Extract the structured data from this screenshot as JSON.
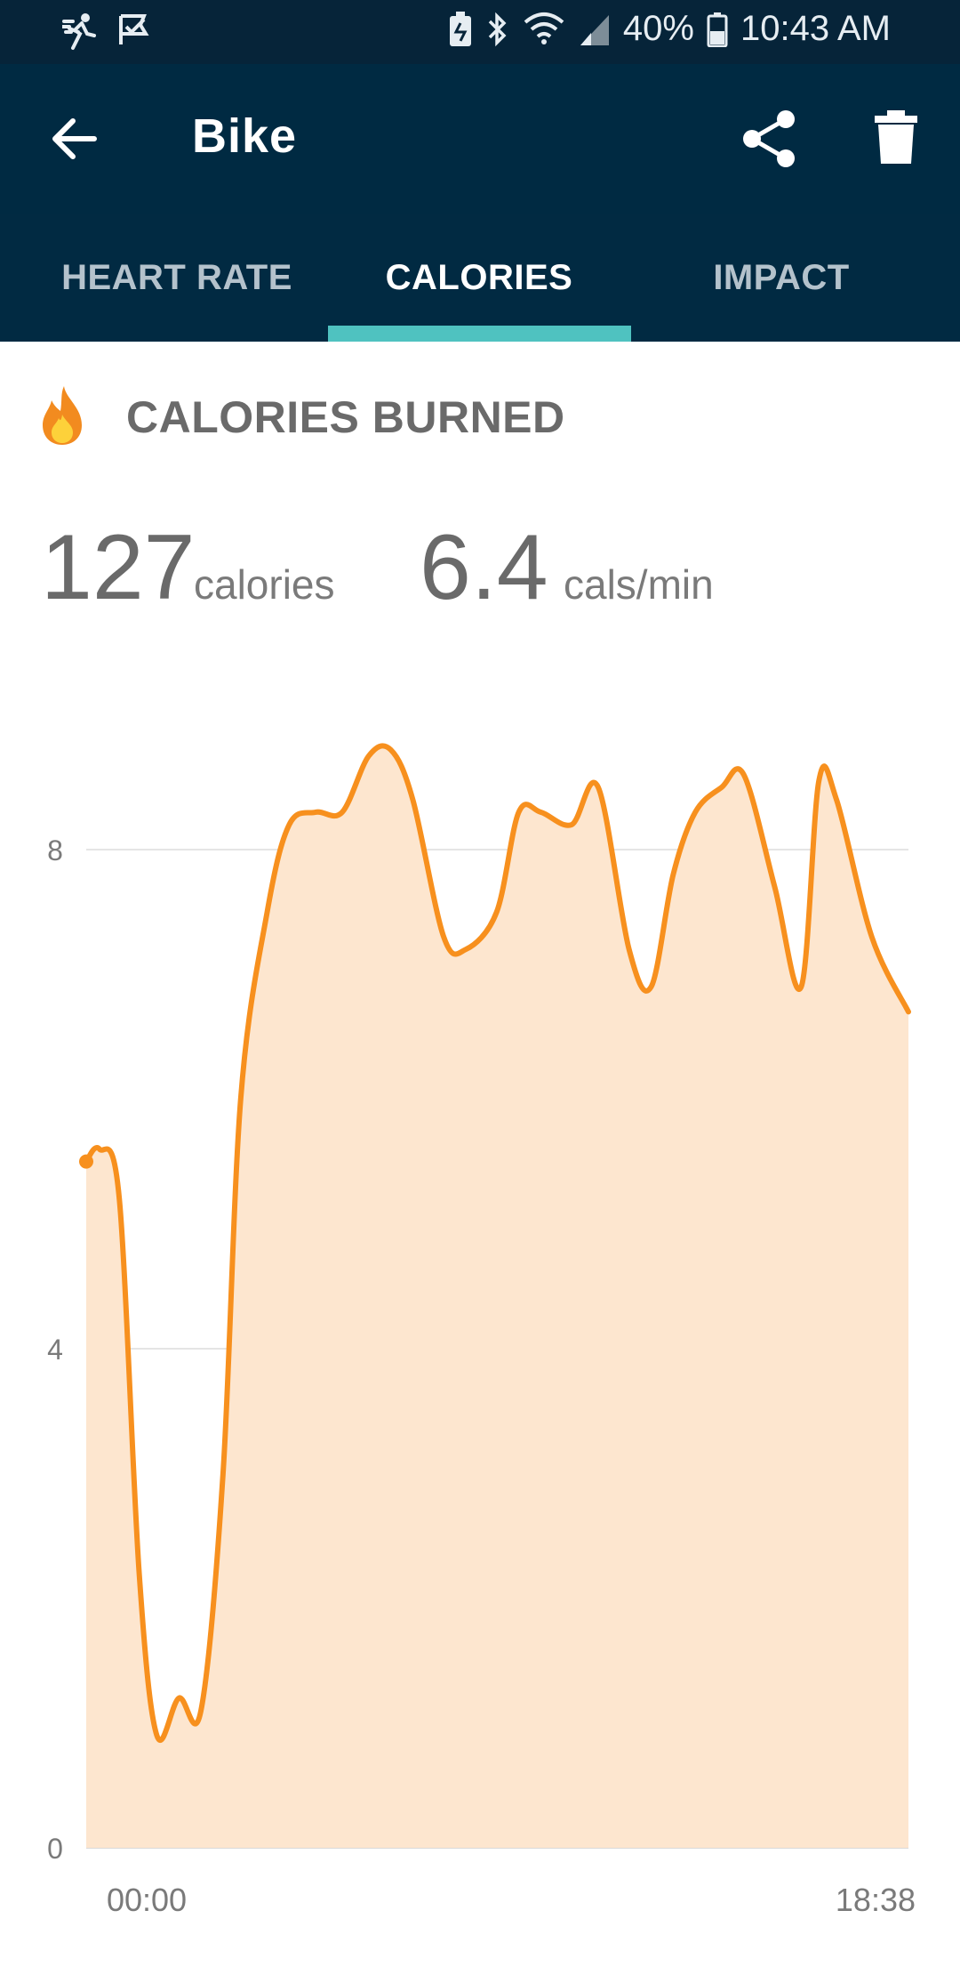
{
  "status_bar": {
    "battery_percent": "40%",
    "time": "10:43 AM",
    "icons": [
      "running-icon",
      "checkmark-flag-icon",
      "battery-saver-icon",
      "bluetooth-icon",
      "wifi-icon",
      "signal-icon",
      "battery-icon"
    ]
  },
  "app_bar": {
    "title": "Bike",
    "icons": [
      "back-arrow-icon",
      "share-icon",
      "trash-icon"
    ]
  },
  "tabs": [
    {
      "label": "HEART RATE",
      "active": false
    },
    {
      "label": "CALORIES",
      "active": true
    },
    {
      "label": "IMPACT",
      "active": false
    }
  ],
  "section": {
    "title": "CALORIES BURNED",
    "icon": "flame-icon"
  },
  "stats": {
    "total_value": "127",
    "total_unit": "calories",
    "rate_value": "6.4",
    "rate_unit": "cals/min"
  },
  "colors": {
    "header_bg": "#002a42",
    "tab_indicator": "#4fc2c0",
    "line": "#f7901e",
    "fill": "#fde6cf",
    "grid": "#e5e5e5"
  },
  "chart_data": {
    "type": "area",
    "ylim": [
      0,
      9
    ],
    "yticks": [
      0,
      4,
      8
    ],
    "ytick_labels": [
      "0",
      "4",
      "8"
    ],
    "x_start_label": "00:00",
    "x_end_label": "18:38",
    "xlim": [
      0,
      18.63
    ],
    "grid": true,
    "x": [
      0,
      0.3,
      0.75,
      1.2,
      1.6,
      2.1,
      2.6,
      3.1,
      3.5,
      4.1,
      4.6,
      5.2,
      5.8,
      6.4,
      6.9,
      7.4,
      8.1,
      8.6,
      9.3,
      9.8,
      10.3,
      11.0,
      11.6,
      12.3,
      12.8,
      13.3,
      13.8,
      14.4,
      14.9,
      15.6,
      16.2,
      16.6,
      17.0,
      17.8,
      18.63
    ],
    "y": [
      5.5,
      5.6,
      5.2,
      2.2,
      0.9,
      1.2,
      1.1,
      3.0,
      6.0,
      7.5,
      8.2,
      8.3,
      8.3,
      8.75,
      8.8,
      8.4,
      7.3,
      7.2,
      7.5,
      8.3,
      8.3,
      8.2,
      8.5,
      7.2,
      6.9,
      7.8,
      8.3,
      8.5,
      8.6,
      7.7,
      6.9,
      8.55,
      8.4,
      7.3,
      6.7
    ]
  }
}
